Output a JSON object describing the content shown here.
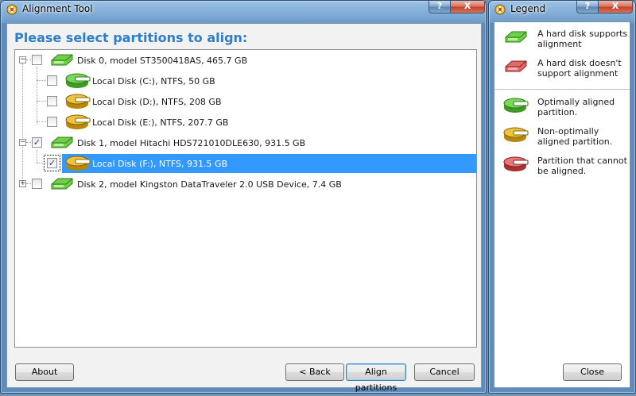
{
  "main_window": {
    "title": "Alignment Tool",
    "help_glyph": "?",
    "close_glyph": "X",
    "heading": "Please select partitions to align:",
    "tree": [
      {
        "label": "Disk 0, model ST3500418AS, 465.7 GB",
        "kind": "disk",
        "expander": "−",
        "checked": false
      },
      {
        "label": "Local Disk (C:), NTFS, 50 GB",
        "kind": "partition",
        "status": "optimal",
        "checked": false
      },
      {
        "label": "Local Disk (D:), NTFS, 208 GB",
        "kind": "partition",
        "status": "non-optimal",
        "checked": false
      },
      {
        "label": "Local Disk (E:), NTFS, 207.7 GB",
        "kind": "partition",
        "status": "non-optimal",
        "checked": false
      },
      {
        "label": "Disk 1, model Hitachi HDS721010DLE630, 931.5 GB",
        "kind": "disk",
        "expander": "−",
        "checked": true
      },
      {
        "label": "Local Disk (F:), NTFS, 931.5 GB",
        "kind": "partition",
        "status": "non-optimal",
        "checked": true,
        "selected": true
      },
      {
        "label": "Disk 2, model Kingston DataTraveler 2.0 USB Device, 7.4 GB",
        "kind": "disk",
        "expander": "+",
        "checked": false
      }
    ],
    "check_glyph": "✓",
    "buttons": {
      "about": "About",
      "back": "< Back",
      "align": "Align partitions",
      "cancel": "Cancel"
    }
  },
  "legend_window": {
    "title": "Legend",
    "help_glyph": "?",
    "close_glyph": "X",
    "items": [
      {
        "text": "A hard disk supports alignment",
        "icon": "disk-green-icon"
      },
      {
        "text": "A hard disk doesn't support alignment",
        "icon": "disk-red-icon"
      },
      {
        "text": "Optimally aligned partition.",
        "icon": "partition-green-icon"
      },
      {
        "text": "Non-optimally aligned partition.",
        "icon": "partition-yellow-icon"
      },
      {
        "text": "Partition that cannot be aligned.",
        "icon": "partition-red-icon"
      }
    ],
    "close_label": "Close"
  },
  "colors": {
    "heading": "#2d7fcc",
    "selection": "#3399ff",
    "green": "#5fbf3a",
    "yellow": "#e0b020",
    "red": "#d25050"
  }
}
